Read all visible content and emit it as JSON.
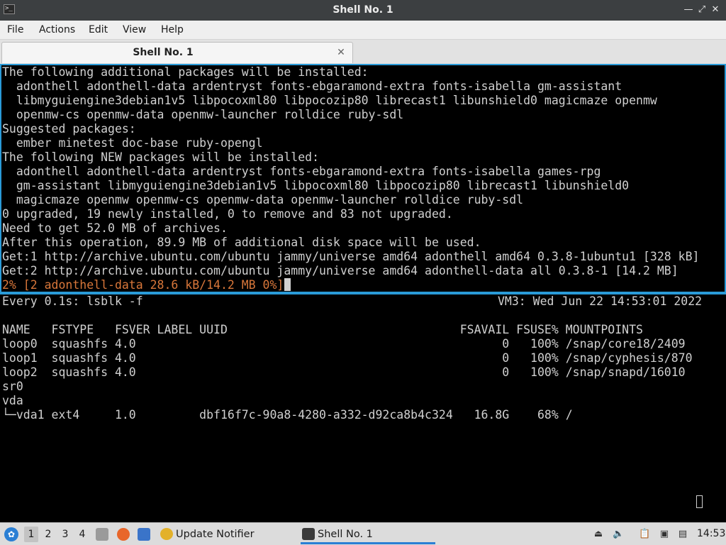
{
  "window": {
    "title": "Shell No. 1",
    "controls": [
      "minimize",
      "maximize",
      "close"
    ]
  },
  "menu": {
    "items": [
      "File",
      "Actions",
      "Edit",
      "View",
      "Help"
    ]
  },
  "tabs": [
    {
      "label": "Shell No. 1",
      "active": true
    }
  ],
  "terminal_top": {
    "lines": [
      "The following additional packages will be installed:",
      "  adonthell adonthell-data ardentryst fonts-ebgaramond-extra fonts-isabella gm-assistant",
      "  libmyguiengine3debian1v5 libpocoxml80 libpocozip80 librecast1 libunshield0 magicmaze openmw",
      "  openmw-cs openmw-data openmw-launcher rolldice ruby-sdl",
      "Suggested packages:",
      "  ember minetest doc-base ruby-opengl",
      "The following NEW packages will be installed:",
      "  adonthell adonthell-data ardentryst fonts-ebgaramond-extra fonts-isabella games-rpg",
      "  gm-assistant libmyguiengine3debian1v5 libpocoxml80 libpocozip80 librecast1 libunshield0",
      "  magicmaze openmw openmw-cs openmw-data openmw-launcher rolldice ruby-sdl",
      "0 upgraded, 19 newly installed, 0 to remove and 83 not upgraded.",
      "Need to get 52.0 MB of archives.",
      "After this operation, 89.9 MB of additional disk space will be used.",
      "Get:1 http://archive.ubuntu.com/ubuntu jammy/universe amd64 adonthell amd64 0.3.8-1ubuntu1 [328 kB]",
      "Get:2 http://archive.ubuntu.com/ubuntu jammy/universe amd64 adonthell-data all 0.3.8-1 [14.2 MB]"
    ],
    "progress_line": "2% [2 adonthell-data 28.6 kB/14.2 MB 0%]"
  },
  "terminal_bottom": {
    "watch_command": "Every 0.1s: lsblk -f",
    "watch_host_time": "VM3: Wed Jun 22 14:53:01 2022",
    "lines": [
      "",
      "NAME   FSTYPE   FSVER LABEL UUID                                 FSAVAIL FSUSE% MOUNTPOINTS",
      "loop0  squashfs 4.0                                                    0   100% /snap/core18/2409",
      "loop1  squashfs 4.0                                                    0   100% /snap/cyphesis/870",
      "loop2  squashfs 4.0                                                    0   100% /snap/snapd/16010",
      "sr0",
      "vda",
      "└─vda1 ext4     1.0         dbf16f7c-90a8-4280-a332-d92ca8b4c324   16.8G    68% /"
    ]
  },
  "taskbar": {
    "workspaces": [
      "1",
      "2",
      "3",
      "4"
    ],
    "active_workspace": "1",
    "quicklaunch_icons": [
      "file-manager-icon",
      "firefox-icon",
      "desktop-icon"
    ],
    "tasks": [
      {
        "label": "Update Notifier",
        "icon": "update-notifier-icon",
        "active": false
      },
      {
        "label": "Shell No. 1",
        "icon": "terminal-icon",
        "active": true
      }
    ],
    "tray_icons": [
      "eject-icon",
      "volume-icon",
      "clipboard-icon",
      "display-icon",
      "network-icon"
    ],
    "clock": "14:53"
  },
  "colors": {
    "titlebar": "#3c3f41",
    "pane_border": "#2a9bd8",
    "progress_text": "#d9773a",
    "taskbar": "#dcdcdc"
  }
}
